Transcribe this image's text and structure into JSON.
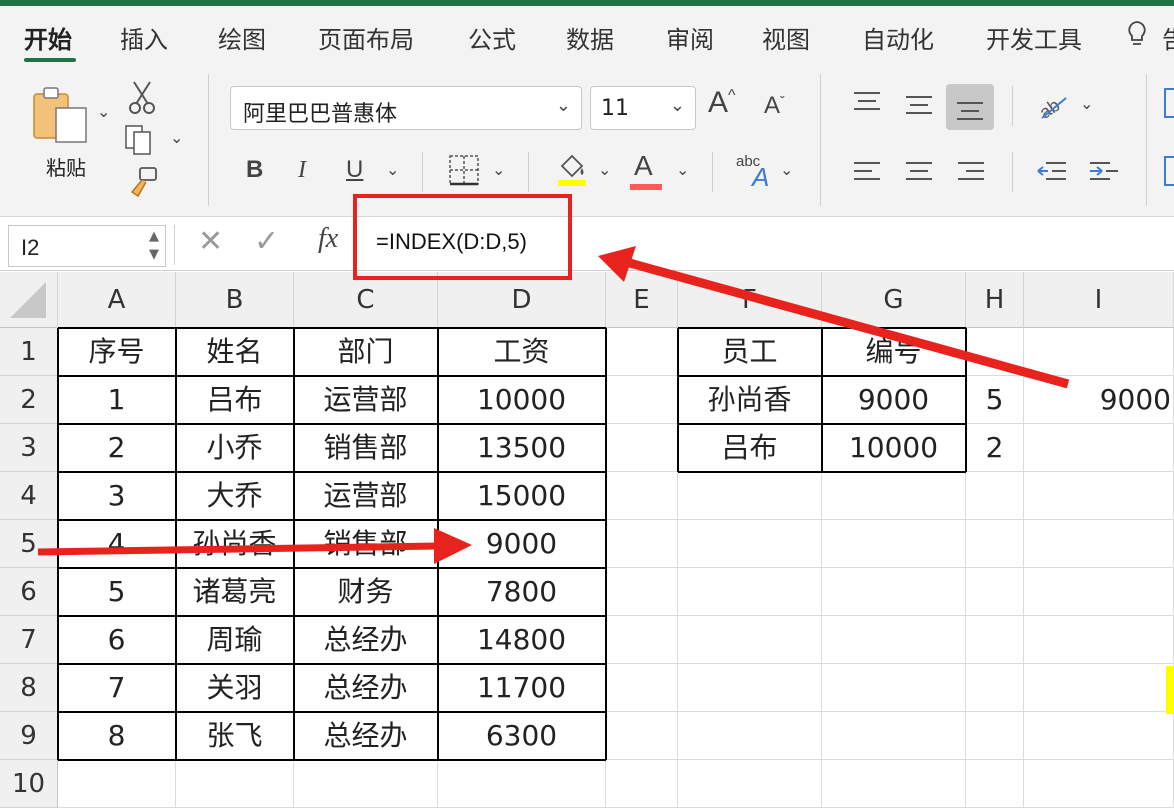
{
  "ribbon_tabs": [
    "开始",
    "插入",
    "绘图",
    "页面布局",
    "公式",
    "数据",
    "审阅",
    "视图",
    "自动化",
    "开发工具"
  ],
  "ribbon_tab_partial": "告",
  "clipboard": {
    "paste_label": "粘贴"
  },
  "font": {
    "name": "阿里巴巴普惠体",
    "size": "11",
    "grow": "A",
    "shrink": "A"
  },
  "format_buttons": {
    "bold": "B",
    "italic": "I",
    "underline": "U",
    "font_color": "A",
    "text_style_small": "abc",
    "text_style_big": "A"
  },
  "formula_bar": {
    "name_box": "I2",
    "fx": "fx",
    "formula": "=INDEX(D:D,5)"
  },
  "columns": [
    "A",
    "B",
    "C",
    "D",
    "E",
    "F",
    "G",
    "H",
    "I"
  ],
  "rows": [
    "1",
    "2",
    "3",
    "4",
    "5",
    "6",
    "7",
    "8",
    "9",
    "10"
  ],
  "main_table": {
    "headers": [
      "序号",
      "姓名",
      "部门",
      "工资"
    ],
    "rows": [
      [
        "1",
        "吕布",
        "运营部",
        "10000"
      ],
      [
        "2",
        "小乔",
        "销售部",
        "13500"
      ],
      [
        "3",
        "大乔",
        "运营部",
        "15000"
      ],
      [
        "4",
        "孙尚香",
        "销售部",
        "9000"
      ],
      [
        "5",
        "诸葛亮",
        "财务",
        "7800"
      ],
      [
        "6",
        "周瑜",
        "总经办",
        "14800"
      ],
      [
        "7",
        "关羽",
        "总经办",
        "11700"
      ],
      [
        "8",
        "张飞",
        "总经办",
        "6300"
      ]
    ]
  },
  "lookup_table": {
    "headers": [
      "员工",
      "编号"
    ],
    "rows": [
      [
        "孙尚香",
        "9000"
      ],
      [
        "吕布",
        "10000"
      ]
    ]
  },
  "h_values": [
    "5",
    "2"
  ],
  "i2_value": "9000",
  "colors": {
    "accent": "#217346",
    "annotation_red": "#e8231e",
    "highlight_yellow": "#ffff00"
  }
}
